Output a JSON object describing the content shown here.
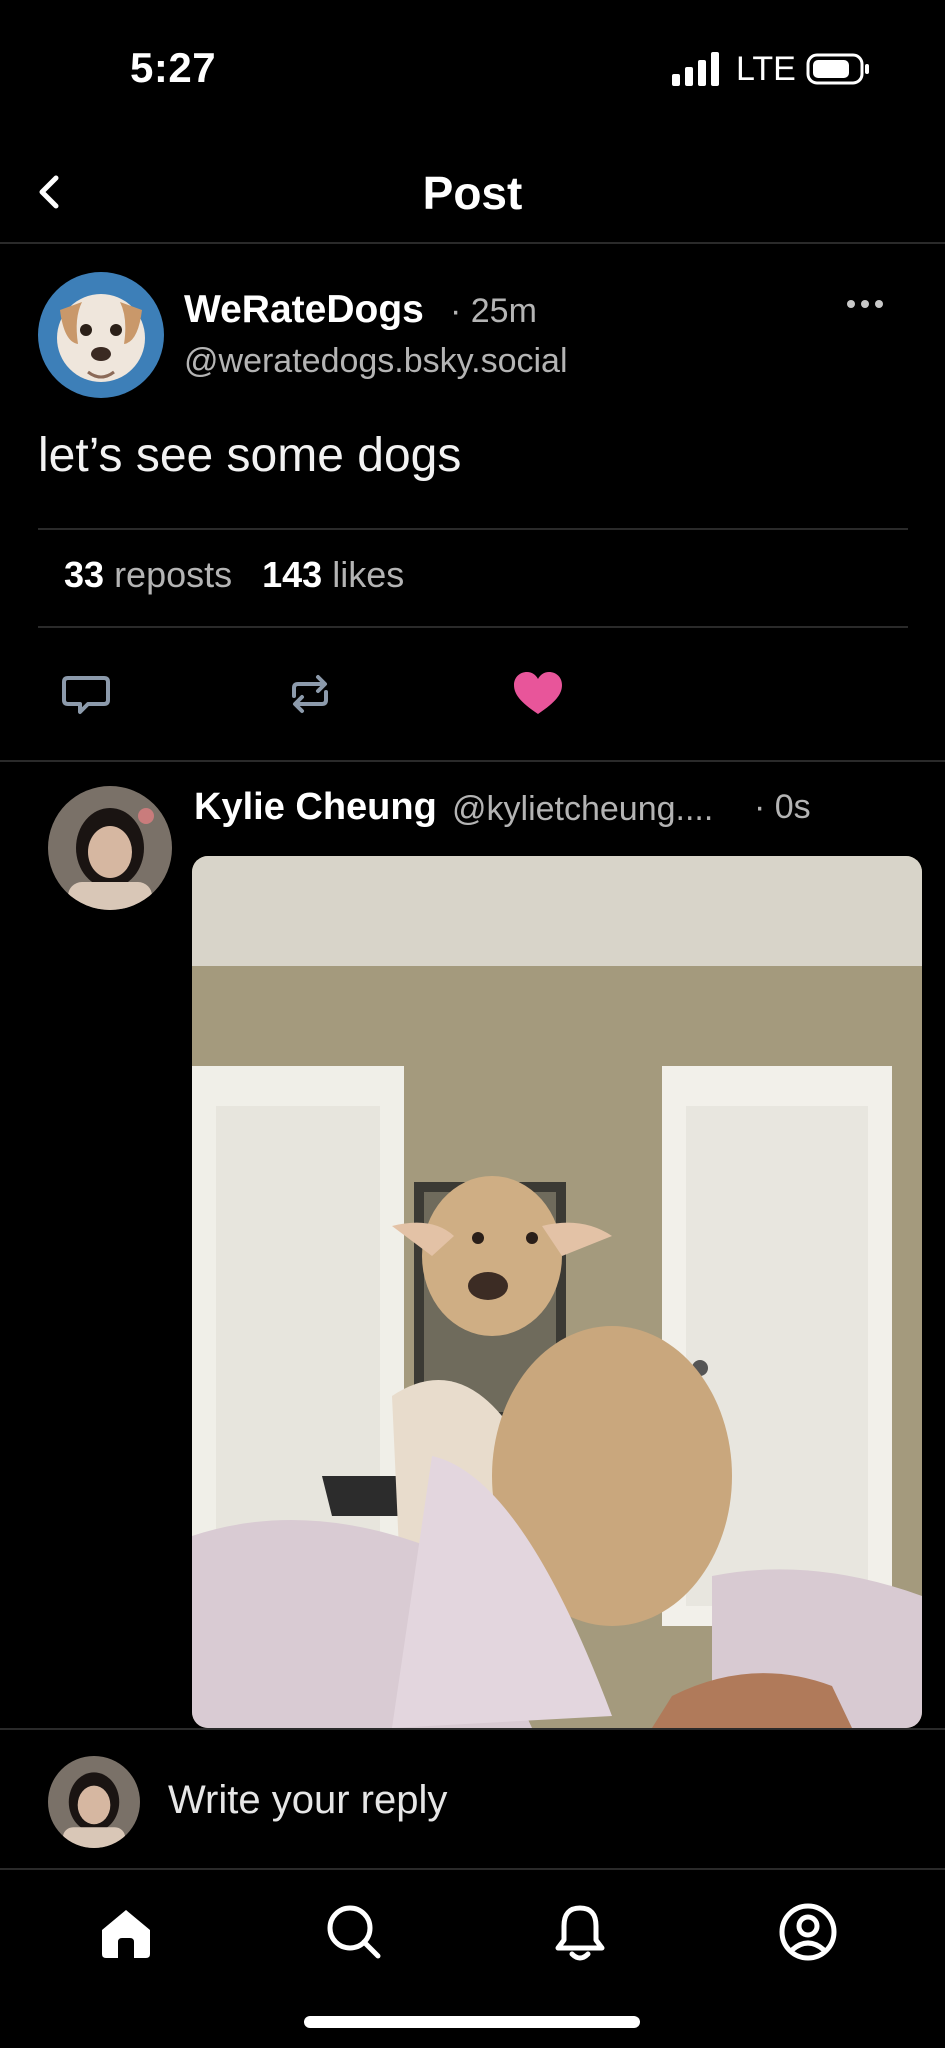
{
  "status_bar": {
    "time": "5:27",
    "network": "LTE"
  },
  "header": {
    "title": "Post"
  },
  "post": {
    "author_name": "WeRateDogs",
    "time": "· 25m",
    "handle": "@weratedogs.bsky.social",
    "text": "let’s see some dogs",
    "reposts_count": "33",
    "reposts_label": "reposts",
    "likes_count": "143",
    "likes_label": "likes",
    "liked": true
  },
  "reply": {
    "author_name": "Kylie Cheung",
    "handle": "@kylietcheung....",
    "time": "· 0s"
  },
  "composer": {
    "placeholder": "Write your reply"
  },
  "colors": {
    "like": "#e8559a",
    "action": "#8c9aab"
  },
  "tabs": [
    "home-icon",
    "search-icon",
    "notifications-icon",
    "profile-icon"
  ]
}
